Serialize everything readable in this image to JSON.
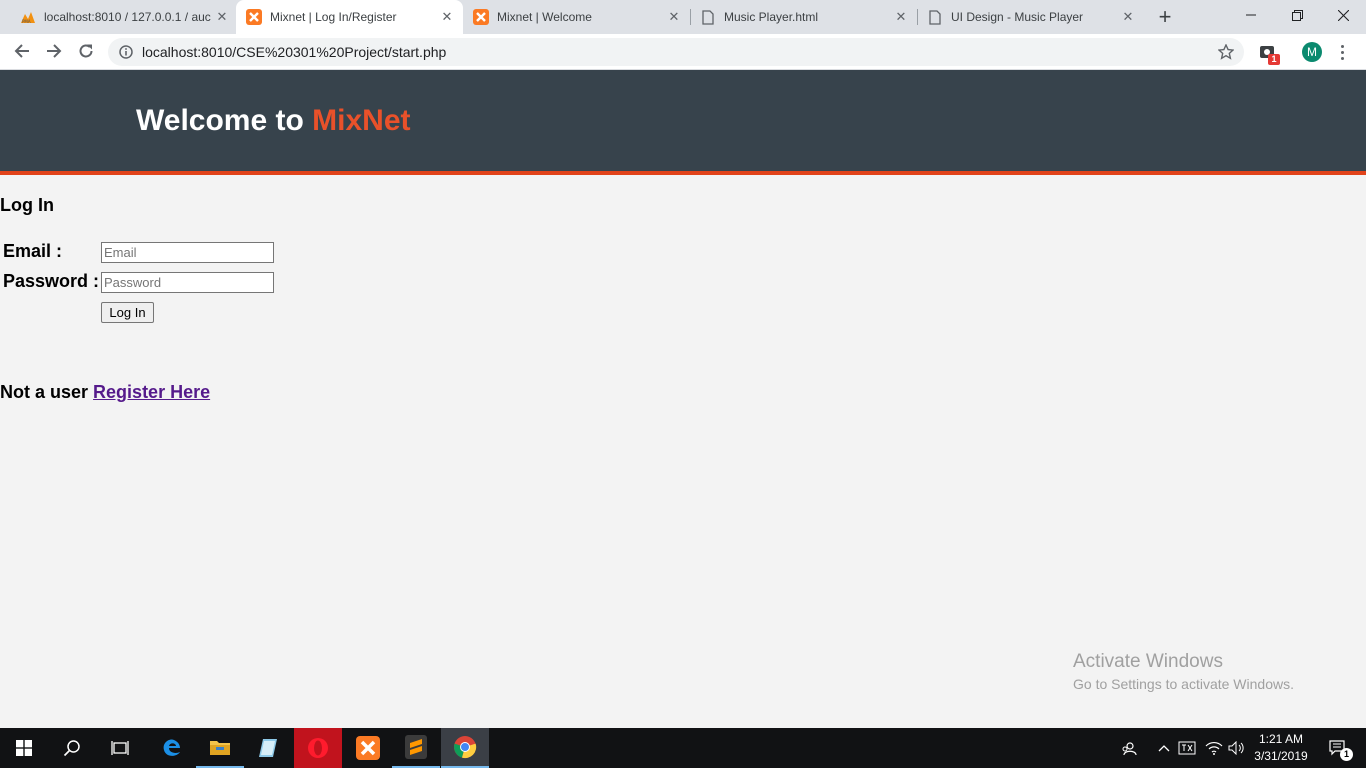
{
  "browser": {
    "tabs": [
      {
        "title": "localhost:8010 / 127.0.0.1 / auc",
        "icon": "phpmyadmin-icon"
      },
      {
        "title": "Mixnet | Log In/Register",
        "icon": "xampp-icon",
        "active": true
      },
      {
        "title": "Mixnet | Welcome",
        "icon": "xampp-icon"
      },
      {
        "title": "Music Player.html",
        "icon": "file-icon"
      },
      {
        "title": "UI Design - Music Player",
        "icon": "file-icon"
      }
    ],
    "url": "localhost:8010/CSE%20301%20Project/start.php",
    "profile_initial": "M",
    "extension_badge": "1"
  },
  "page": {
    "header": {
      "welcome": "Welcome to",
      "brand": "MixNet"
    },
    "login": {
      "heading": "Log In",
      "email_label": "Email :",
      "email_placeholder": "Email",
      "password_label": "Password :",
      "password_placeholder": "Password",
      "submit": "Log In"
    },
    "register": {
      "prompt": "Not a user",
      "link": "Register Here"
    }
  },
  "watermark": {
    "line1": "Activate Windows",
    "line2": "Go to Settings to activate Windows."
  },
  "taskbar": {
    "time": "1:21 AM",
    "date": "3/31/2019",
    "notification_count": "1",
    "apps": [
      "start-icon",
      "search-icon",
      "task-view-icon",
      "edge-icon",
      "file-explorer-icon",
      "notepad-icon",
      "opera-icon",
      "xampp-icon",
      "sublime-text-icon",
      "chrome-icon"
    ]
  },
  "colors": {
    "header_bg": "#37434c",
    "accent": "#e1431a",
    "brand": "#e9512a",
    "link": "#551a8b"
  }
}
